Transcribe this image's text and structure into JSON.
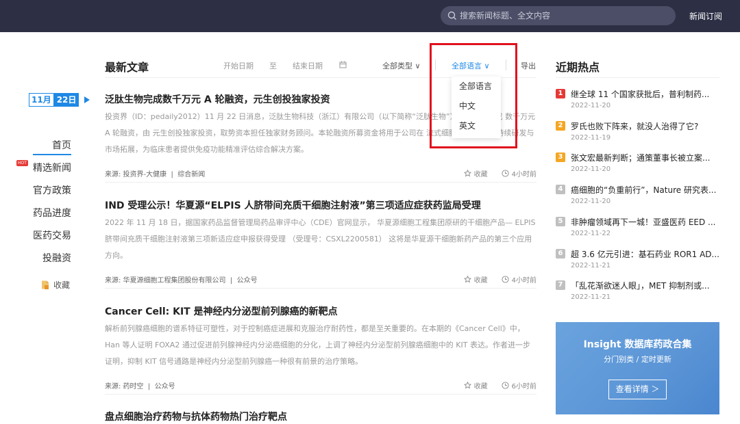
{
  "topbar": {
    "search_placeholder": "搜索新闻标题、全文内容",
    "subscribe": "新闻订阅"
  },
  "sidebar": {
    "date_month": "11月",
    "date_day": "22日",
    "items": [
      {
        "label": "首页",
        "active": true
      },
      {
        "label": "精选新闻",
        "badge": "HOT"
      },
      {
        "label": "官方政策"
      },
      {
        "label": "药品进度"
      },
      {
        "label": "医药交易"
      },
      {
        "label": "投融资"
      }
    ],
    "favorites": "收藏"
  },
  "main": {
    "title": "最新文章",
    "filters": {
      "start_date": "开始日期",
      "to": "至",
      "end_date": "结束日期",
      "type": "全部类型",
      "language": "全部语言",
      "export": "导出"
    },
    "language_options": [
      "全部语言",
      "中文",
      "英文"
    ],
    "articles": [
      {
        "title": "泛肽生物完成数千万元 A 轮融资，元生创投独家投资",
        "summary": "投资界（ID：pedaily2012）11 月 22 日消息，泛肽生物科技（浙江）有限公司（以下简称“泛肽生物”）近日宣布完成 数千万元 A 轮融资，由 元生创投独家投资，取势资本担任独家财务顾问。本轮融资所募资金将用于公司在 流式细胞技术平台 的持续研发与市场拓展，为临床患者提供免疫功能精准评估综合解决方案。",
        "source": "来源: 投资界-大健康",
        "category": "综合新闻",
        "fav": "收藏",
        "time": "4小时前"
      },
      {
        "title": "IND 受理公示！华夏源“ELPIS 人脐带间充质干细胞注射液”第三项适应症获药监局受理",
        "summary": "2022 年 11 月 18 日，据国家药品监督管理局药品审评中心（CDE）官网显示， 华夏源细胞工程集团原研的干细胞产品— ELPIS 脐带间充质干细胞注射液第三项新适应症申报获得受理 （受理号：CSXL2200581） 这将是华夏源干细胞新药产品的第三个应用方向。",
        "source": "来源: 华夏源细胞工程集团股份有限公司",
        "category": "公众号",
        "fav": "收藏",
        "time": "4小时前"
      },
      {
        "title": "Cancer Cell: KIT 是神经内分泌型前列腺癌的新靶点",
        "summary": "解析前列腺癌细胞的谱系特征可塑性，对于控制癌症进展和克服治疗耐药性，都是至关重要的。在本期的《Cancer Cell》中，Han 等人证明 FOXA2 通过促进前列腺神经内分泌癌细胞的分化，上调了神经内分泌型前列腺癌细胞中的 KIT 表达。作者进一步证明，抑制 KIT 信号通路是神经内分泌型前列腺癌一种很有前景的治疗策略。",
        "source": "来源: 药时空",
        "category": "公众号",
        "fav": "收藏",
        "time": "6小时前"
      },
      {
        "title": "盘点细胞治疗药物与抗体药物热门治疗靶点"
      }
    ]
  },
  "side": {
    "title": "近期热点",
    "items": [
      {
        "rank": "1",
        "title": "继全球 11 个国家获批后，普利制药...",
        "date": "2022-11-20",
        "color": "#e53935"
      },
      {
        "rank": "2",
        "title": "罗氏也败下阵来，就没人治得了它?",
        "date": "2022-11-19",
        "color": "#f5a623"
      },
      {
        "rank": "3",
        "title": "张文宏最新判断；通策董事长被立案...",
        "date": "2022-11-20",
        "color": "#f5a623"
      },
      {
        "rank": "4",
        "title": "癌细胞的“负重前行”，Nature 研究表...",
        "date": "2022-11-20",
        "color": "#c0c0c0"
      },
      {
        "rank": "5",
        "title": "非肿瘤领域再下一城！亚盛医药 EED ...",
        "date": "2022-11-22",
        "color": "#c0c0c0"
      },
      {
        "rank": "6",
        "title": "超 3.6 亿元引进：基石药业 ROR1 AD...",
        "date": "2022-11-21",
        "color": "#c0c0c0"
      },
      {
        "rank": "7",
        "title": "「乱花渐欲迷人眼」，MET 抑制剂或...",
        "date": "2022-11-21",
        "color": "#c0c0c0"
      }
    ],
    "banner": {
      "title": "Insight 数据库药政合集",
      "subtitle": "分门别类 / 定时更新",
      "button": "查看详情 ＞"
    }
  }
}
